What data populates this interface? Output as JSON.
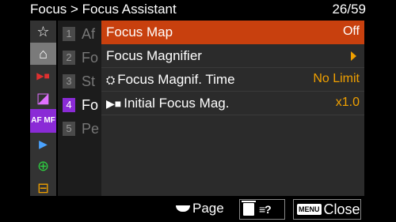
{
  "header": {
    "breadcrumb": "Focus > Focus Assistant",
    "page_counter": "26/59"
  },
  "tabs": [
    {
      "icon": "star-icon",
      "glyph": "☆"
    },
    {
      "icon": "home-camera-icon",
      "glyph": "⌂"
    },
    {
      "icon": "movie-icon",
      "glyph": "▶■"
    },
    {
      "icon": "exposure-icon",
      "glyph": "◪"
    },
    {
      "icon": "af-mf-icon",
      "glyph": "AF MF"
    },
    {
      "icon": "playback-icon",
      "glyph": "▶"
    },
    {
      "icon": "network-icon",
      "glyph": "⊕"
    },
    {
      "icon": "toolbox-icon",
      "glyph": "⊟"
    }
  ],
  "pages": [
    {
      "num": "1",
      "abbr": "Af"
    },
    {
      "num": "2",
      "abbr": "Fo"
    },
    {
      "num": "3",
      "abbr": "St"
    },
    {
      "num": "4",
      "abbr": "Fo"
    },
    {
      "num": "5",
      "abbr": "Pe"
    }
  ],
  "menu": {
    "items": [
      {
        "label": "Focus Map",
        "value": "Off"
      },
      {
        "label": "Focus Magnifier",
        "value": ""
      },
      {
        "label": "Focus Magnif. Time",
        "value": "No Limit"
      },
      {
        "label": "Initial Focus Mag.",
        "value": "x1.0"
      }
    ]
  },
  "footer": {
    "page_label": "Page",
    "menu_badge": "MENU",
    "close_label": "Close",
    "help_glyph": "≡?"
  },
  "colors": {
    "selected_row": "#c8400e",
    "value_text": "#f0a000",
    "tab_accent": "#8a2bd6"
  }
}
